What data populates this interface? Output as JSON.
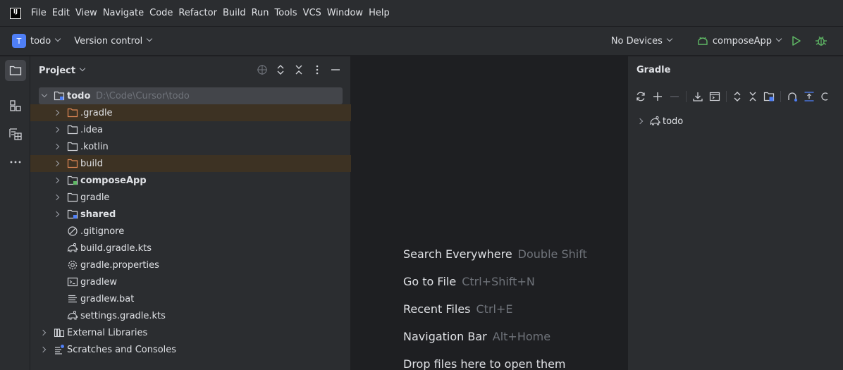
{
  "menubar": {
    "logo": "IJ",
    "items": [
      "File",
      "Edit",
      "View",
      "Navigate",
      "Code",
      "Refactor",
      "Build",
      "Run",
      "Tools",
      "VCS",
      "Window",
      "Help"
    ]
  },
  "toolbar": {
    "project_badge": "T",
    "project_name": "todo",
    "version_control": "Version control",
    "devices": "No Devices",
    "run_config": "composeApp",
    "icons": [
      "android-icon",
      "run-icon",
      "debug-icon"
    ]
  },
  "project_panel": {
    "title": "Project",
    "tree": {
      "root": {
        "name": "todo",
        "path": "D:\\Code\\Cursor\\todo"
      },
      "items": [
        {
          "label": ".gradle"
        },
        {
          "label": ".idea"
        },
        {
          "label": ".kotlin"
        },
        {
          "label": "build"
        },
        {
          "label": "composeApp"
        },
        {
          "label": "gradle"
        },
        {
          "label": "shared"
        },
        {
          "label": ".gitignore"
        },
        {
          "label": "build.gradle.kts"
        },
        {
          "label": "gradle.properties"
        },
        {
          "label": "gradlew"
        },
        {
          "label": "gradlew.bat"
        },
        {
          "label": "settings.gradle.kts"
        },
        {
          "label": "External Libraries"
        },
        {
          "label": "Scratches and Consoles"
        }
      ]
    }
  },
  "editor": {
    "hints": [
      {
        "label": "Search Everywhere",
        "shortcut": "Double Shift"
      },
      {
        "label": "Go to File",
        "shortcut": "Ctrl+Shift+N"
      },
      {
        "label": "Recent Files",
        "shortcut": "Ctrl+E"
      },
      {
        "label": "Navigation Bar",
        "shortcut": "Alt+Home"
      },
      {
        "label": "Drop files here to open them",
        "shortcut": ""
      }
    ]
  },
  "gradle_panel": {
    "title": "Gradle",
    "node": "todo"
  },
  "colors": {
    "background": "#1e1f22",
    "panel": "#2b2d30",
    "accent": "#4f7ff6",
    "excluded_row": "#3d3223",
    "run_green": "#5fb865",
    "excluded_folder": "#e08855"
  }
}
